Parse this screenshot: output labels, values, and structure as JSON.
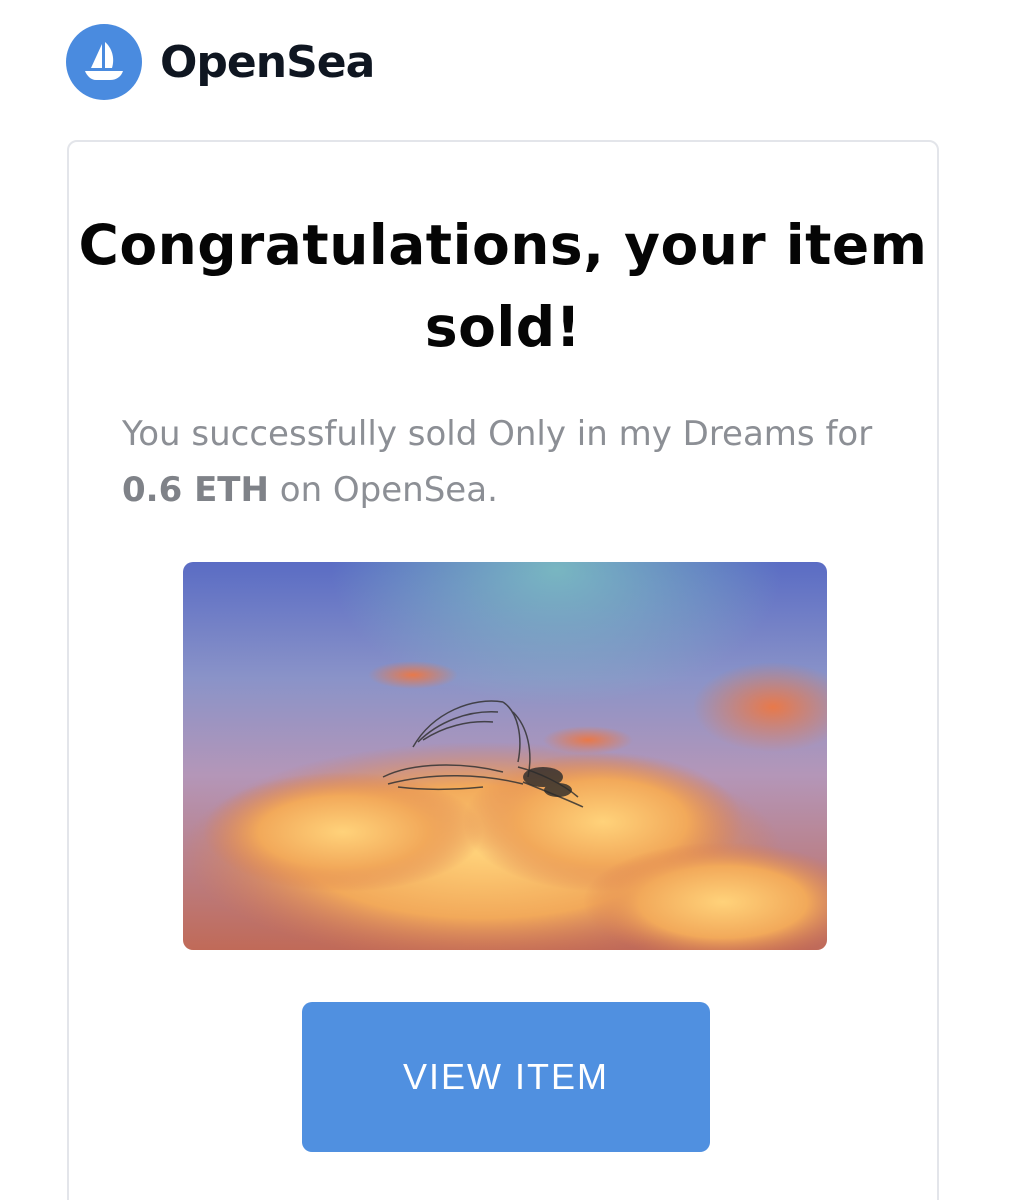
{
  "brand": {
    "name": "OpenSea",
    "logo_icon": "ship-icon",
    "accent_color": "#4a8bdf"
  },
  "email": {
    "headline": "Congratulations, your item sold!",
    "message_prefix": "You successfully sold Only in my Dreams for ",
    "price": "0.6 ETH",
    "message_suffix": " on OpenSea.",
    "item_image_icon": "nft-artwork-image",
    "view_button_label": "VIEW ITEM",
    "button_color": "#5090e0"
  }
}
